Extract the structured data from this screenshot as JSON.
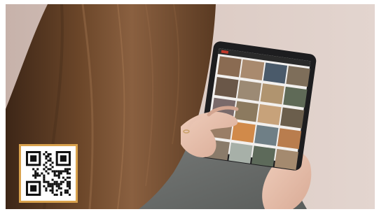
{
  "scene": {
    "subject": "woman-using-tablet",
    "colors": {
      "background": "#d9c7c0",
      "hair": "#5a3a24",
      "sweater": "#6b6e6c",
      "tablet": "#1d1d1f",
      "skin": "#e6c0ad",
      "qr_border": "#d9a24d"
    }
  },
  "qr_code": {
    "icon": "qr-code-icon"
  },
  "tablet": {
    "app_header_color": "#2a2a2a",
    "tile_colors": [
      "#8a6b52",
      "#a98a6e",
      "#4a5a6a",
      "#7e6e5a",
      "#6a5748",
      "#9c8a74",
      "#b0946f",
      "#5f6a57",
      "#7a6a6a",
      "#8c7a5f",
      "#c7a27a",
      "#6b5e4c",
      "#9a7e66",
      "#d18a4a",
      "#6f7f86",
      "#b97d4e",
      "#8a7b6a",
      "#a7b0a8",
      "#5d6a5a",
      "#a48a6f"
    ]
  }
}
